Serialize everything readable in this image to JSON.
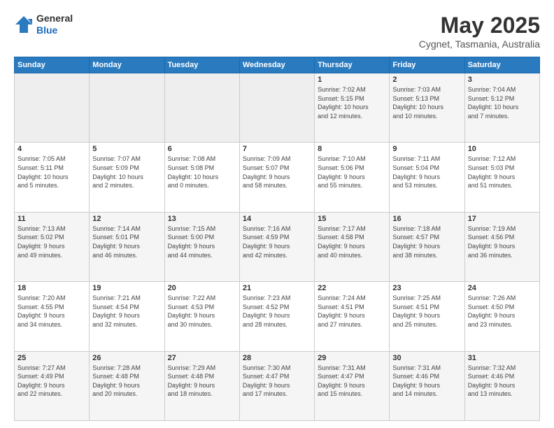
{
  "header": {
    "logo_general": "General",
    "logo_blue": "Blue",
    "main_title": "May 2025",
    "subtitle": "Cygnet, Tasmania, Australia"
  },
  "calendar": {
    "days_of_week": [
      "Sunday",
      "Monday",
      "Tuesday",
      "Wednesday",
      "Thursday",
      "Friday",
      "Saturday"
    ],
    "weeks": [
      [
        {
          "day": "",
          "info": ""
        },
        {
          "day": "",
          "info": ""
        },
        {
          "day": "",
          "info": ""
        },
        {
          "day": "",
          "info": ""
        },
        {
          "day": "1",
          "info": "Sunrise: 7:02 AM\nSunset: 5:15 PM\nDaylight: 10 hours\nand 12 minutes."
        },
        {
          "day": "2",
          "info": "Sunrise: 7:03 AM\nSunset: 5:13 PM\nDaylight: 10 hours\nand 10 minutes."
        },
        {
          "day": "3",
          "info": "Sunrise: 7:04 AM\nSunset: 5:12 PM\nDaylight: 10 hours\nand 7 minutes."
        }
      ],
      [
        {
          "day": "4",
          "info": "Sunrise: 7:05 AM\nSunset: 5:11 PM\nDaylight: 10 hours\nand 5 minutes."
        },
        {
          "day": "5",
          "info": "Sunrise: 7:07 AM\nSunset: 5:09 PM\nDaylight: 10 hours\nand 2 minutes."
        },
        {
          "day": "6",
          "info": "Sunrise: 7:08 AM\nSunset: 5:08 PM\nDaylight: 10 hours\nand 0 minutes."
        },
        {
          "day": "7",
          "info": "Sunrise: 7:09 AM\nSunset: 5:07 PM\nDaylight: 9 hours\nand 58 minutes."
        },
        {
          "day": "8",
          "info": "Sunrise: 7:10 AM\nSunset: 5:06 PM\nDaylight: 9 hours\nand 55 minutes."
        },
        {
          "day": "9",
          "info": "Sunrise: 7:11 AM\nSunset: 5:04 PM\nDaylight: 9 hours\nand 53 minutes."
        },
        {
          "day": "10",
          "info": "Sunrise: 7:12 AM\nSunset: 5:03 PM\nDaylight: 9 hours\nand 51 minutes."
        }
      ],
      [
        {
          "day": "11",
          "info": "Sunrise: 7:13 AM\nSunset: 5:02 PM\nDaylight: 9 hours\nand 49 minutes."
        },
        {
          "day": "12",
          "info": "Sunrise: 7:14 AM\nSunset: 5:01 PM\nDaylight: 9 hours\nand 46 minutes."
        },
        {
          "day": "13",
          "info": "Sunrise: 7:15 AM\nSunset: 5:00 PM\nDaylight: 9 hours\nand 44 minutes."
        },
        {
          "day": "14",
          "info": "Sunrise: 7:16 AM\nSunset: 4:59 PM\nDaylight: 9 hours\nand 42 minutes."
        },
        {
          "day": "15",
          "info": "Sunrise: 7:17 AM\nSunset: 4:58 PM\nDaylight: 9 hours\nand 40 minutes."
        },
        {
          "day": "16",
          "info": "Sunrise: 7:18 AM\nSunset: 4:57 PM\nDaylight: 9 hours\nand 38 minutes."
        },
        {
          "day": "17",
          "info": "Sunrise: 7:19 AM\nSunset: 4:56 PM\nDaylight: 9 hours\nand 36 minutes."
        }
      ],
      [
        {
          "day": "18",
          "info": "Sunrise: 7:20 AM\nSunset: 4:55 PM\nDaylight: 9 hours\nand 34 minutes."
        },
        {
          "day": "19",
          "info": "Sunrise: 7:21 AM\nSunset: 4:54 PM\nDaylight: 9 hours\nand 32 minutes."
        },
        {
          "day": "20",
          "info": "Sunrise: 7:22 AM\nSunset: 4:53 PM\nDaylight: 9 hours\nand 30 minutes."
        },
        {
          "day": "21",
          "info": "Sunrise: 7:23 AM\nSunset: 4:52 PM\nDaylight: 9 hours\nand 28 minutes."
        },
        {
          "day": "22",
          "info": "Sunrise: 7:24 AM\nSunset: 4:51 PM\nDaylight: 9 hours\nand 27 minutes."
        },
        {
          "day": "23",
          "info": "Sunrise: 7:25 AM\nSunset: 4:51 PM\nDaylight: 9 hours\nand 25 minutes."
        },
        {
          "day": "24",
          "info": "Sunrise: 7:26 AM\nSunset: 4:50 PM\nDaylight: 9 hours\nand 23 minutes."
        }
      ],
      [
        {
          "day": "25",
          "info": "Sunrise: 7:27 AM\nSunset: 4:49 PM\nDaylight: 9 hours\nand 22 minutes."
        },
        {
          "day": "26",
          "info": "Sunrise: 7:28 AM\nSunset: 4:48 PM\nDaylight: 9 hours\nand 20 minutes."
        },
        {
          "day": "27",
          "info": "Sunrise: 7:29 AM\nSunset: 4:48 PM\nDaylight: 9 hours\nand 18 minutes."
        },
        {
          "day": "28",
          "info": "Sunrise: 7:30 AM\nSunset: 4:47 PM\nDaylight: 9 hours\nand 17 minutes."
        },
        {
          "day": "29",
          "info": "Sunrise: 7:31 AM\nSunset: 4:47 PM\nDaylight: 9 hours\nand 15 minutes."
        },
        {
          "day": "30",
          "info": "Sunrise: 7:31 AM\nSunset: 4:46 PM\nDaylight: 9 hours\nand 14 minutes."
        },
        {
          "day": "31",
          "info": "Sunrise: 7:32 AM\nSunset: 4:46 PM\nDaylight: 9 hours\nand 13 minutes."
        }
      ]
    ]
  }
}
